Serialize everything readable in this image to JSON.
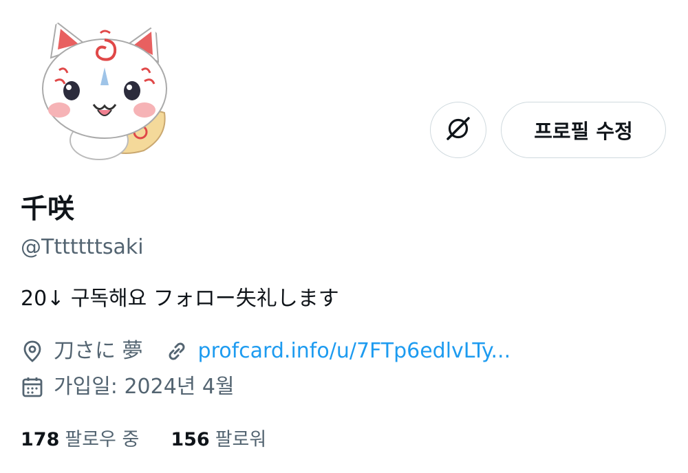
{
  "profile": {
    "display_name": "千咲",
    "handle": "@Tttttttsaki",
    "bio": "20↓ 구독해요 フォロー失礼します",
    "location": "刀さに 夢",
    "website": "profcard.info/u/7FTp6edlvLTy...",
    "joined": "가입일: 2024년 4월"
  },
  "actions": {
    "edit_profile_label": "프로필 수정"
  },
  "stats": {
    "following_count": "178",
    "following_label": "팔로우 중",
    "followers_count": "156",
    "followers_label": "팔로워"
  },
  "icons": {
    "avatar": "fox-mascot-avatar",
    "circle_button": "disconnected-icon",
    "location": "location-pin-icon",
    "link": "link-icon",
    "calendar": "calendar-icon"
  },
  "colors": {
    "link": "#1d9bf0",
    "secondary_text": "#536471",
    "border": "#cfd9de"
  }
}
